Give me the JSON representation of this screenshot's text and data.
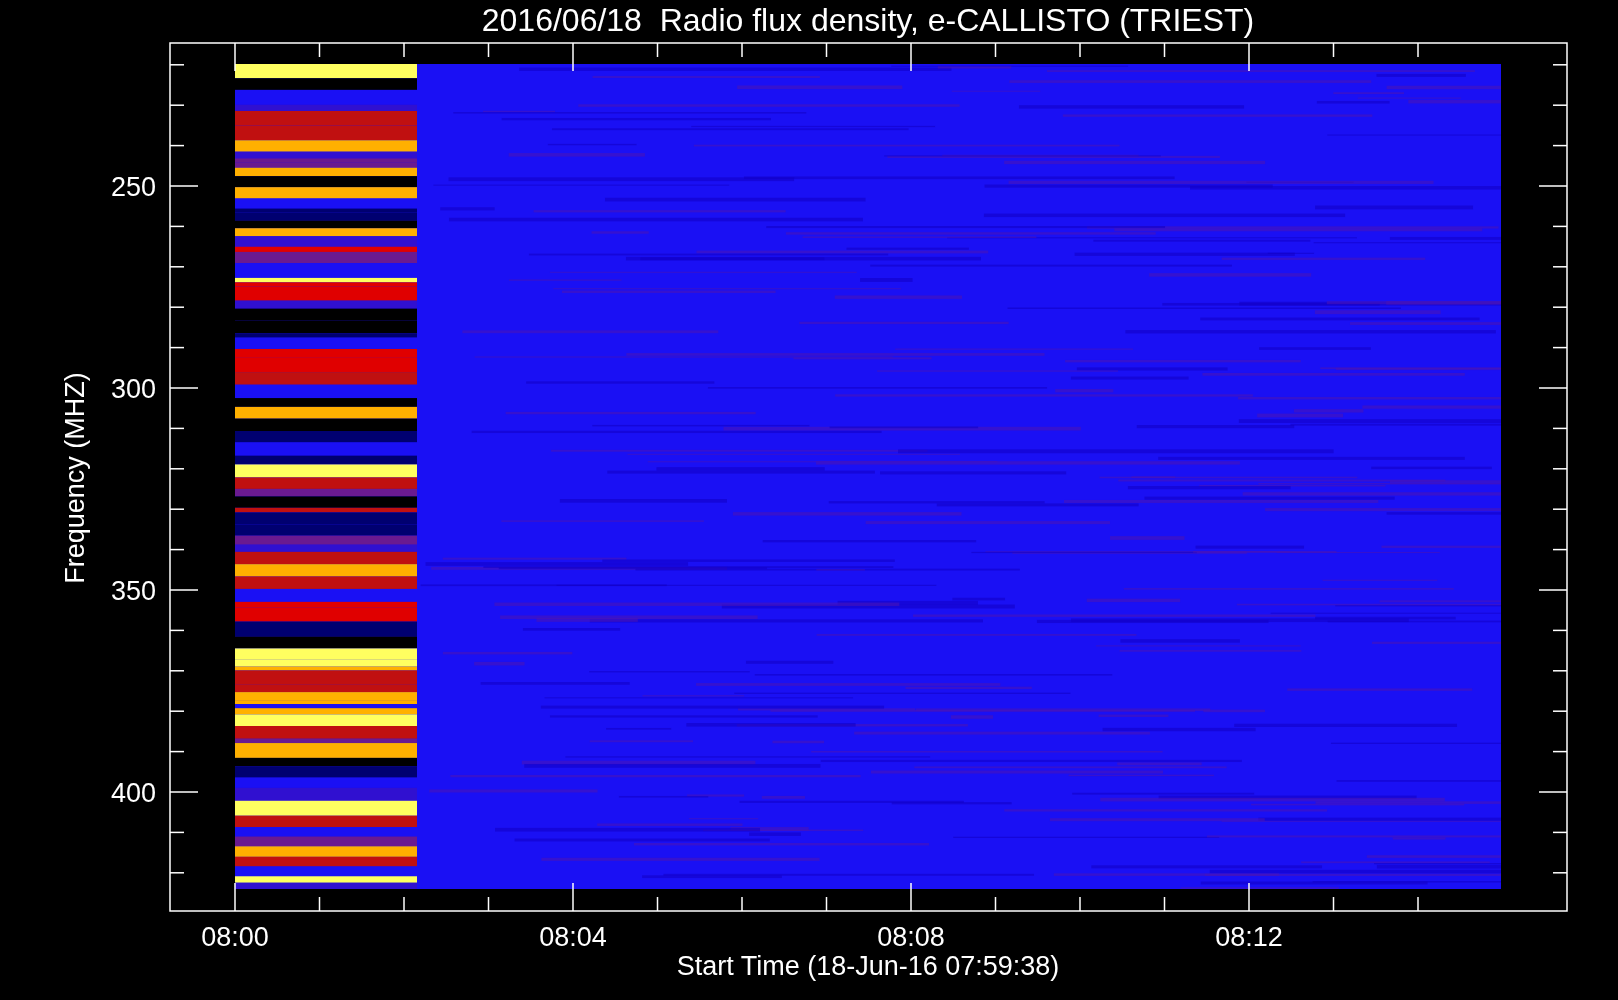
{
  "title": "2016/06/18  Radio flux density, e-CALLISTO (TRIEST)",
  "y_axis": {
    "label": "Frequency (MHZ)",
    "ticks": [
      {
        "label": "250"
      },
      {
        "label": "300"
      },
      {
        "label": "350"
      },
      {
        "label": "400"
      }
    ]
  },
  "x_axis": {
    "label": "Start Time (18-Jun-16 07:59:38)",
    "ticks": [
      {
        "label": "08:00"
      },
      {
        "label": "08:04"
      },
      {
        "label": "08:08"
      },
      {
        "label": "08:12"
      }
    ]
  }
}
